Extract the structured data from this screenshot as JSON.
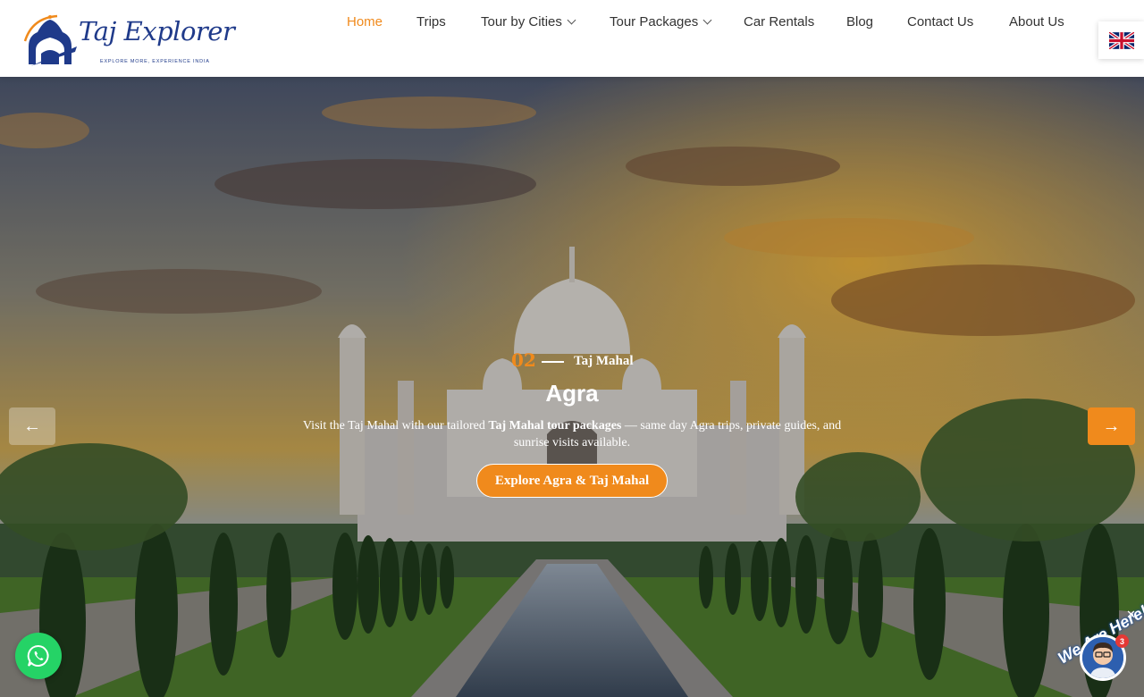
{
  "brand": {
    "name": "Taj Explorer",
    "tagline": "EXPLORE MORE, EXPERIENCE INDIA"
  },
  "nav": {
    "items": [
      {
        "label": "Home",
        "active": true
      },
      {
        "label": "Trips"
      },
      {
        "label": "Tour by Cities",
        "dropdown": true
      },
      {
        "label": "Tour Packages",
        "dropdown": true
      },
      {
        "label": "Car Rentals"
      },
      {
        "label": "Blog"
      },
      {
        "label": "Contact Us"
      },
      {
        "label": "About Us"
      }
    ],
    "language_icon": "uk-flag-icon"
  },
  "hero": {
    "slide_number": "02",
    "slide_subtitle": "Taj Mahal",
    "title": "Agra",
    "description_prefix": "Visit the Taj Mahal with our tailored ",
    "description_bold": "Taj Mahal tour packages",
    "description_suffix": " — same day Agra trips, private guides, and sunrise visits available.",
    "cta_label": "Explore Agra & Taj Mahal",
    "prev_label": "←",
    "next_label": "→"
  },
  "floating": {
    "chat_label": "We Are Here!",
    "chat_badge": "3",
    "close_label": "✕"
  },
  "colors": {
    "accent": "#f08a1c",
    "brand_blue": "#1f3a8a",
    "whatsapp": "#25d366"
  }
}
